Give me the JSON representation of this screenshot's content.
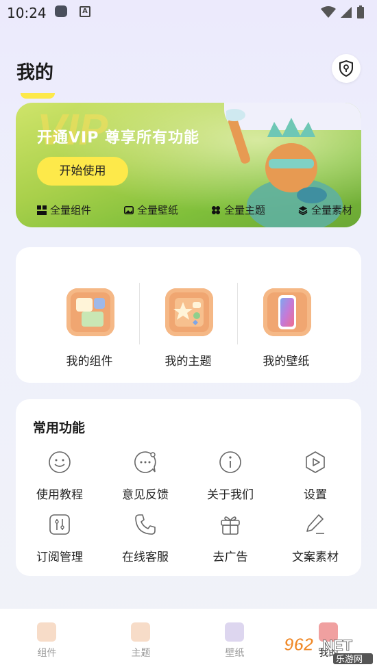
{
  "status": {
    "time": "10:24",
    "a_label": "A"
  },
  "header": {
    "title": "我的"
  },
  "vip": {
    "bg_text": "VIP",
    "title": "开通VIP 尊享所有功能",
    "button": "开始使用",
    "perks": [
      {
        "icon": "widget-icon",
        "label": "全量组件"
      },
      {
        "icon": "wallpaper-icon",
        "label": "全量壁纸"
      },
      {
        "icon": "theme-icon",
        "label": "全量主题"
      },
      {
        "icon": "layers-icon",
        "label": "全量素材"
      }
    ]
  },
  "my": {
    "items": [
      {
        "icon": "widget-3d-icon",
        "label": "我的组件"
      },
      {
        "icon": "theme-3d-icon",
        "label": "我的主题"
      },
      {
        "icon": "phone-wallpaper-3d-icon",
        "label": "我的壁纸"
      }
    ]
  },
  "functions": {
    "title": "常用功能",
    "items": [
      {
        "icon": "smile-icon",
        "label": "使用教程"
      },
      {
        "icon": "chat-bubble-icon",
        "label": "意见反馈"
      },
      {
        "icon": "info-icon",
        "label": "关于我们"
      },
      {
        "icon": "settings-icon",
        "label": "设置"
      },
      {
        "icon": "subscription-icon",
        "label": "订阅管理"
      },
      {
        "icon": "phone-icon",
        "label": "在线客服"
      },
      {
        "icon": "gift-icon",
        "label": "去广告"
      },
      {
        "icon": "pen-icon",
        "label": "文案素材"
      }
    ]
  },
  "nav": {
    "items": [
      {
        "icon": "widget-nav-icon",
        "label": "组件"
      },
      {
        "icon": "theme-nav-icon",
        "label": "主题"
      },
      {
        "icon": "wallpaper-nav-icon",
        "label": "壁纸"
      },
      {
        "icon": "mine-nav-icon",
        "label": "我的"
      }
    ]
  },
  "watermark": {
    "text": "962.NET",
    "subtext": "乐游网"
  },
  "colors": {
    "accent_yellow": "#fde94a",
    "icon_orange": "#f0a671",
    "card_bg": "#ffffff"
  }
}
